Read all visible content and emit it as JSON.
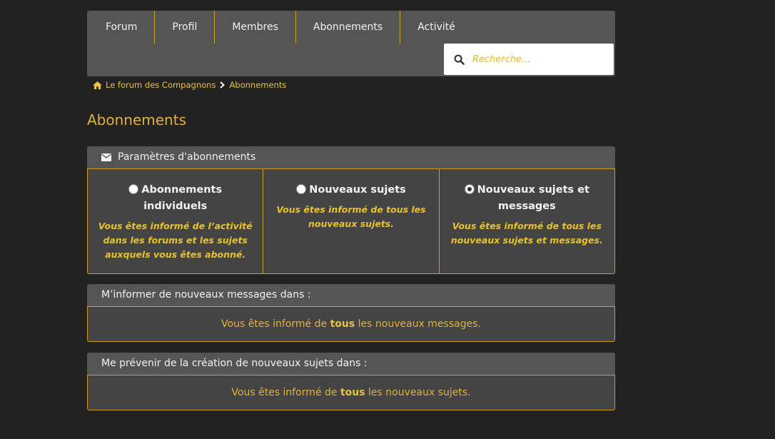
{
  "nav": {
    "items": [
      "Forum",
      "Profil",
      "Membres",
      "Abonnements",
      "Activité"
    ]
  },
  "search": {
    "placeholder": "Recherche..."
  },
  "breadcrumb": {
    "home": "Le forum des Compagnons",
    "current": "Abonnements"
  },
  "page": {
    "title": "Abonnements"
  },
  "settings": {
    "header": "Paramètres d'abonnements",
    "options": [
      {
        "label": "Abonnements individuels",
        "desc": "Vous êtes informé de l’activité dans les forums et les sujets auxquels vous êtes abonné.",
        "checked": false
      },
      {
        "label": "Nouveaux sujets",
        "desc": "Vous êtes informé de tous les nouveaux sujets.",
        "checked": false
      },
      {
        "label": "Nouveaux sujets et messages",
        "desc": "Vous êtes informé de tous les nouveaux sujets et messages.",
        "checked": true
      }
    ]
  },
  "messages_panel": {
    "header": "M’informer de nouveaux messages dans :",
    "text_before": "Vous êtes informé de ",
    "text_bold": "tous",
    "text_after": " les nouveaux messages."
  },
  "topics_panel": {
    "header": "Me prévenir de la création de nouveaux sujets dans :",
    "text_before": "Vous êtes informé de ",
    "text_bold": "tous",
    "text_after": " les nouveaux sujets."
  },
  "colors": {
    "accent": "#e0b13f",
    "background": "#222222",
    "panel": "#444444",
    "header": "#555555"
  }
}
